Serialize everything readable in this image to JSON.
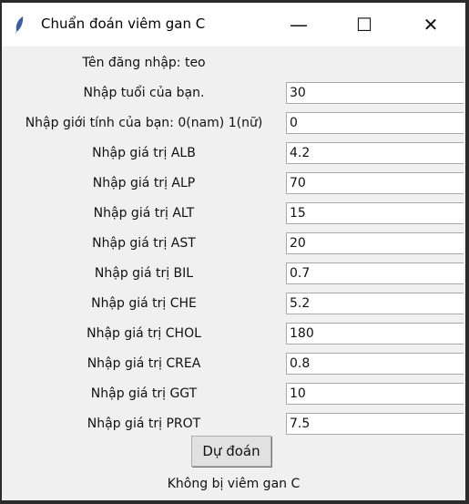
{
  "window": {
    "title": "Chuẩn đoán viêm gan C",
    "minimize": "—",
    "maximize": "☐",
    "close": "✕"
  },
  "username_label": "Tên đăng nhập: teo",
  "fields": [
    {
      "label": "Nhập tuổi của bạn.",
      "value": "30"
    },
    {
      "label": "Nhập giới tính của bạn: 0(nam) 1(nữ)",
      "value": "0"
    },
    {
      "label": "Nhập giá trị ALB",
      "value": "4.2"
    },
    {
      "label": "Nhập giá trị ALP",
      "value": "70"
    },
    {
      "label": "Nhập giá trị ALT",
      "value": "15"
    },
    {
      "label": "Nhập giá trị AST",
      "value": "20"
    },
    {
      "label": "Nhập giá trị BIL",
      "value": "0.7"
    },
    {
      "label": "Nhập giá trị CHE",
      "value": "5.2"
    },
    {
      "label": "Nhập giá trị CHOL",
      "value": "180"
    },
    {
      "label": "Nhập giá trị CREA",
      "value": "0.8"
    },
    {
      "label": "Nhập giá trị GGT",
      "value": "10"
    },
    {
      "label": "Nhập giá trị PROT",
      "value": "7.5"
    }
  ],
  "predict_button": "Dự đoán",
  "result": "Không bị viêm gan C"
}
